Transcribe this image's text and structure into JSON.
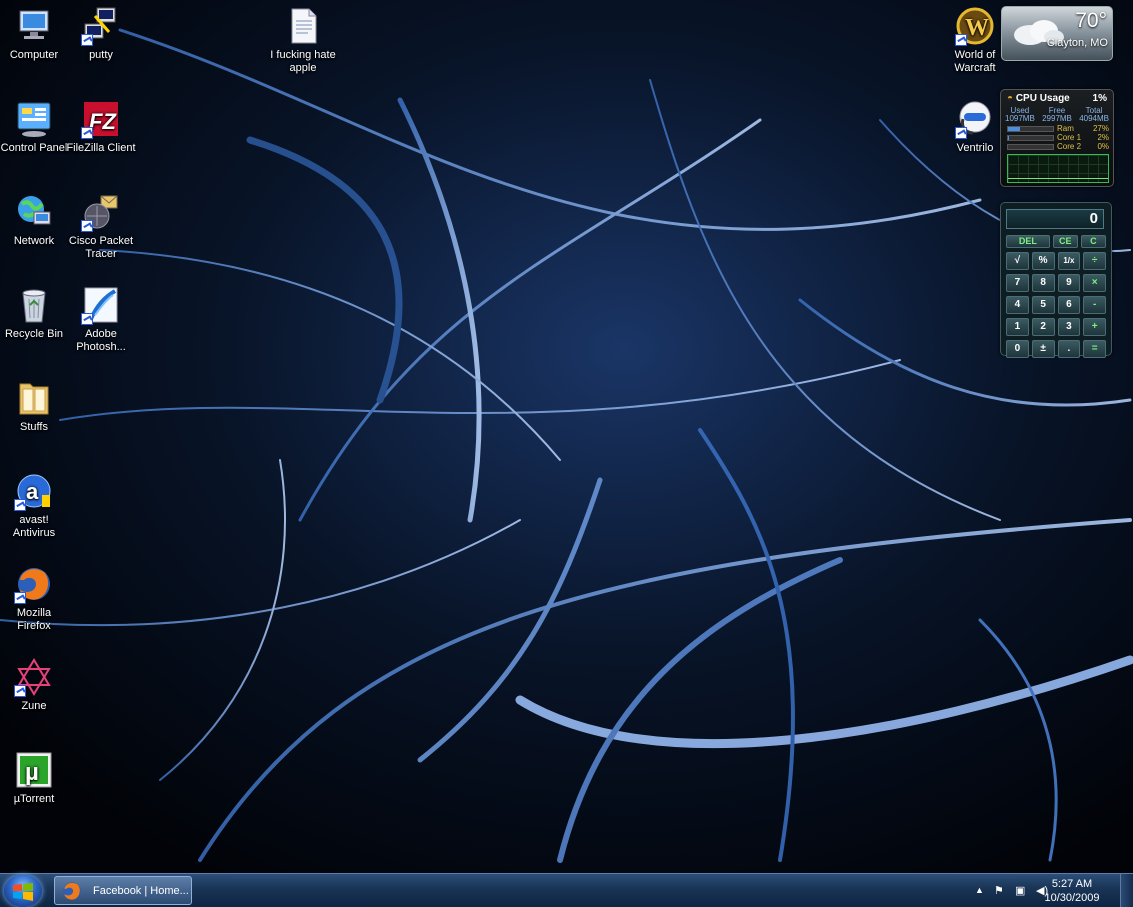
{
  "desktop": {
    "icons": [
      {
        "label": "Computer",
        "icon": "computer-icon"
      },
      {
        "label": "putty",
        "icon": "putty-icon"
      },
      {
        "label": "I fucking hate apple",
        "icon": "document-icon"
      },
      {
        "label": "Control Panel",
        "icon": "control-panel-icon"
      },
      {
        "label": "FileZilla Client",
        "icon": "filezilla-icon"
      },
      {
        "label": "Network",
        "icon": "network-icon"
      },
      {
        "label": "Cisco Packet Tracer",
        "icon": "packet-tracer-icon"
      },
      {
        "label": "Recycle Bin",
        "icon": "recycle-bin-icon"
      },
      {
        "label": "Adobe Photosh...",
        "icon": "photoshop-icon"
      },
      {
        "label": "Stuffs",
        "icon": "folder-icon"
      },
      {
        "label": "avast! Antivirus",
        "icon": "avast-icon"
      },
      {
        "label": "Mozilla Firefox",
        "icon": "firefox-icon"
      },
      {
        "label": "Zune",
        "icon": "zune-icon"
      },
      {
        "label": "µTorrent",
        "icon": "utorrent-icon"
      },
      {
        "label": "World of Warcraft",
        "icon": "warcraft-icon"
      },
      {
        "label": "Ventrilo",
        "icon": "ventrilo-icon"
      }
    ]
  },
  "weather": {
    "temp": "70°",
    "location": "Clayton, MO"
  },
  "cpu": {
    "title": "CPU Usage",
    "percent": "1%",
    "stats": [
      {
        "k": "Used",
        "v": "1097MB"
      },
      {
        "k": "Free",
        "v": "2997MB"
      },
      {
        "k": "Total",
        "v": "4094MB"
      }
    ],
    "rows": [
      {
        "name": "Ram",
        "value": "27%",
        "level": 0.27
      },
      {
        "name": "Core 1",
        "value": "2%",
        "level": 0.02
      },
      {
        "name": "Core 2",
        "value": "0%",
        "level": 0.0
      }
    ]
  },
  "calculator": {
    "display": "0",
    "keys": [
      [
        "DEL",
        "CE",
        "C"
      ],
      [
        "√",
        "%",
        "1/x",
        "÷"
      ],
      [
        "7",
        "8",
        "9",
        "×"
      ],
      [
        "4",
        "5",
        "6",
        "-"
      ],
      [
        "1",
        "2",
        "3",
        "+"
      ],
      [
        "0",
        "±",
        ".",
        "="
      ]
    ]
  },
  "taskbar": {
    "task_label": "Facebook | Home...",
    "time": "5:27 AM",
    "date": "10/30/2009",
    "tray_icons": [
      "up-arrow-icon",
      "flag-icon",
      "network-tray-icon",
      "volume-icon"
    ]
  },
  "colors": {
    "accent": "#2c66c8",
    "wallpaper": "#0a1a3a"
  }
}
